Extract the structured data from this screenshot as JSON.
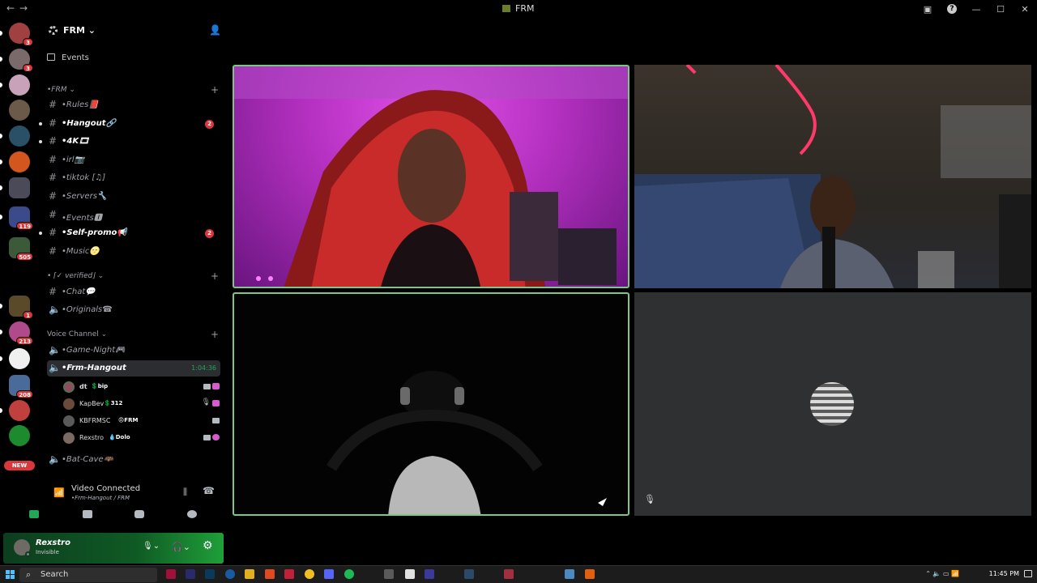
{
  "window": {
    "title": "FRM"
  },
  "rail": {
    "badges": [
      "3",
      "3",
      "119",
      "505",
      "1",
      "213",
      "208"
    ],
    "new_label": "NEW"
  },
  "server": {
    "name": "FRM"
  },
  "events_label": "Events",
  "categories": {
    "frm": "•FRM",
    "verified": "• ⌈✓ verified⌋",
    "voice": "Voice Channel"
  },
  "channels": [
    {
      "label": "•Rules📕"
    },
    {
      "label": "•Hangout🔗",
      "count": "2"
    },
    {
      "label": "•4K🎞"
    },
    {
      "label": "•irl📷"
    },
    {
      "label": "•tiktok [♫]"
    },
    {
      "label": "•Servers🔧"
    },
    {
      "label": "•Events🅸"
    },
    {
      "label": "•Self-promo📢",
      "count": "2"
    },
    {
      "label": "•Music🌝"
    },
    {
      "label": "•Chat💬"
    },
    {
      "label": "•Originals☎"
    }
  ],
  "voice_channels": {
    "game_night": "•Game-Night🎮",
    "frm_hangout": "•Frm-Hangout",
    "frm_hangout_timer": "1:04:36",
    "bat_cave": "•Bat-Cave🦇"
  },
  "voice_users": [
    {
      "name": "dt",
      "tag": "💲bip"
    },
    {
      "name": "KapBev",
      "tag": "💲312"
    },
    {
      "name": "KBFRMSC",
      "tag": "😠FRM"
    },
    {
      "name": "Rexstro",
      "tag": "💧Dolo"
    }
  ],
  "voice_panel": {
    "status": "Video Connected",
    "location": "•Frm-Hangout / FRM"
  },
  "user": {
    "name": "Rexstro",
    "status": "Invisible"
  },
  "taskbar": {
    "search_placeholder": "Search",
    "time": "11:45 PM"
  },
  "colors": {
    "speaking_border": "#7cc787",
    "badge_red": "#da373c",
    "connected_green": "#23a55a"
  }
}
